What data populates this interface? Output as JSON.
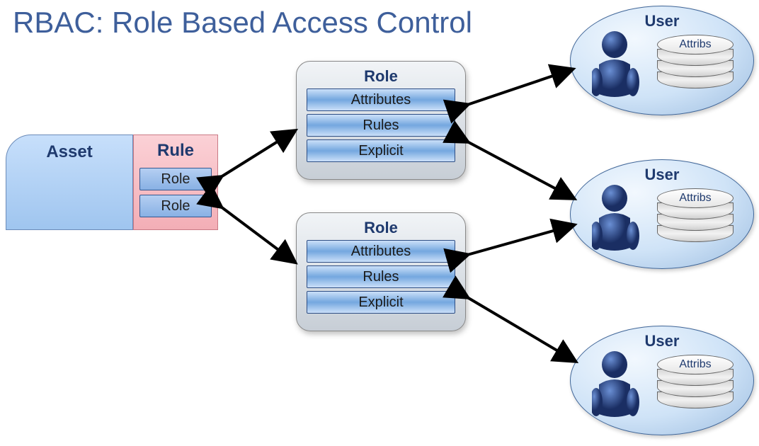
{
  "title": "RBAC: Role Based Access Control",
  "asset": {
    "label": "Asset"
  },
  "rule": {
    "label": "Rule",
    "items": [
      "Role",
      "Role"
    ]
  },
  "roles": [
    {
      "title": "Role",
      "items": [
        "Attributes",
        "Rules",
        "Explicit"
      ]
    },
    {
      "title": "Role",
      "items": [
        "Attributes",
        "Rules",
        "Explicit"
      ]
    }
  ],
  "users": [
    {
      "label": "User",
      "attribs": "Attribs"
    },
    {
      "label": "User",
      "attribs": "Attribs"
    },
    {
      "label": "User",
      "attribs": "Attribs"
    }
  ]
}
